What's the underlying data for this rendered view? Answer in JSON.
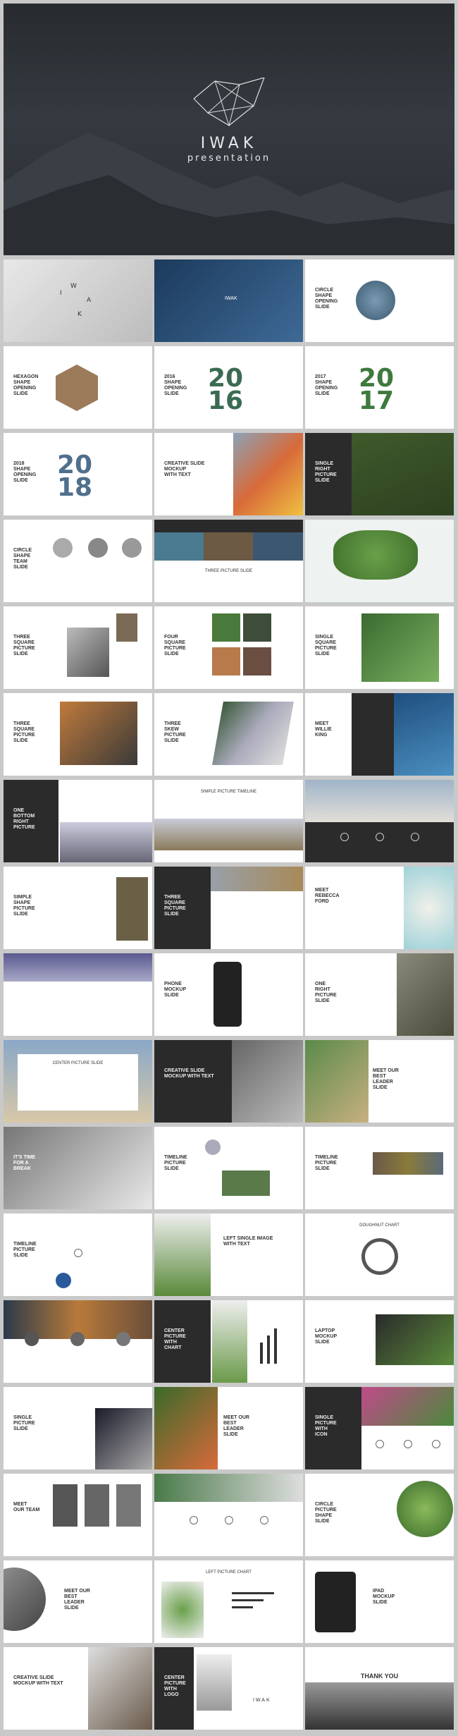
{
  "hero": {
    "title": "IWAK",
    "subtitle": "presentation"
  },
  "slides": [
    {
      "id": "s1",
      "title": ""
    },
    {
      "id": "s2",
      "title": "IWAK"
    },
    {
      "id": "s3",
      "title": "CIRCLE\nSHAPE\nOPENING\nSLIDE"
    },
    {
      "id": "s4",
      "title": "HEXAGON\nSHAPE\nOPENING\nSLIDE"
    },
    {
      "id": "s5",
      "title": "2016\nSHAPE\nOPENING\nSLIDE",
      "year": "20\n16"
    },
    {
      "id": "s6",
      "title": "2017\nSHAPE\nOPENING\nSLIDE",
      "year": "20\n17"
    },
    {
      "id": "s7",
      "title": "2018\nSHAPE\nOPENING\nSLIDE",
      "year": "20\n18"
    },
    {
      "id": "s8",
      "title": "CREATIVE SLIDE\nMOCKUP\nWITH TEXT"
    },
    {
      "id": "s9",
      "title": "SINGLE\nRIGHT\nPICTURE\nSLIDE"
    },
    {
      "id": "s10",
      "title": "CIRCLE\nSHAPE\nTEAM\nSLIDE"
    },
    {
      "id": "s11",
      "title": "THREE PICTURE SLIDE"
    },
    {
      "id": "s12",
      "title": ""
    },
    {
      "id": "s13",
      "title": "THREE\nSQUARE\nPICTURE\nSLIDE"
    },
    {
      "id": "s14",
      "title": "FOUR\nSQUARE\nPICTURE\nSLIDE"
    },
    {
      "id": "s15",
      "title": "SINGLE\nSQUARE\nPICTURE\nSLIDE"
    },
    {
      "id": "s16",
      "title": "THREE\nSQUARE\nPICTURE\nSLIDE"
    },
    {
      "id": "s17",
      "title": "THREE\nSKEW\nPICTURE\nSLIDE"
    },
    {
      "id": "s18",
      "title": "MEET\nWILLIE\nKING"
    },
    {
      "id": "s19",
      "title": "ONE\nBOTTOM\nRIGHT\nPICTURE"
    },
    {
      "id": "s20",
      "title": "SIMPLE PICTURE TIMELINE"
    },
    {
      "id": "s21",
      "title": ""
    },
    {
      "id": "s22",
      "title": "SIMPLE\nSHAPE\nPICTURE\nSLIDE"
    },
    {
      "id": "s23",
      "title": "THREE\nSQUARE\nPICTURE\nSLIDE"
    },
    {
      "id": "s24",
      "title": "MEET\nREBECCA\nFORD"
    },
    {
      "id": "s25",
      "title": ""
    },
    {
      "id": "s26",
      "title": "PHONE\nMOCKUP\nSLIDE"
    },
    {
      "id": "s27",
      "title": "ONE\nRIGHT\nPICTURE\nSLIDE"
    },
    {
      "id": "s28",
      "title": "CENTER PICTURE SLIDE"
    },
    {
      "id": "s29",
      "title": "CREATIVE SLIDE\nMOCKUP WITH TEXT"
    },
    {
      "id": "s30",
      "title": "MEET OUR\nBEST\nLEADER\nSLIDE"
    },
    {
      "id": "s31",
      "title": "IT'S TIME\nFOR A\nBREAK"
    },
    {
      "id": "s32",
      "title": "TIMELINE\nPICTURE\nSLIDE"
    },
    {
      "id": "s33",
      "title": "TIMELINE\nPICTURE\nSLIDE"
    },
    {
      "id": "s34",
      "title": "TIMELINE\nPICTURE\nSLIDE"
    },
    {
      "id": "s35",
      "title": "LEFT SINGLE IMAGE\nWITH TEXT"
    },
    {
      "id": "s36",
      "title": "DOUGHNUT CHART"
    },
    {
      "id": "s37",
      "title": ""
    },
    {
      "id": "s38",
      "title": "CENTER\nPICTURE\nWITH\nCHART"
    },
    {
      "id": "s39",
      "title": "LAPTOP\nMOCKUP\nSLIDE"
    },
    {
      "id": "s40",
      "title": "SINGLE\nPICTURE\nSLIDE"
    },
    {
      "id": "s41",
      "title": "MEET OUR\nBEST\nLEADER\nSLIDE"
    },
    {
      "id": "s42",
      "title": "SINGLE\nPICTURE\nWITH\nICON"
    },
    {
      "id": "s43",
      "title": "MEET\nOUR TEAM"
    },
    {
      "id": "s44",
      "title": ""
    },
    {
      "id": "s45",
      "title": "CIRCLE\nPICTURE\nSHAPE\nSLIDE"
    },
    {
      "id": "s46",
      "title": "MEET OUR\nBEST\nLEADER\nSLIDE"
    },
    {
      "id": "s47",
      "title": "LEFT PICTURE CHART"
    },
    {
      "id": "s48",
      "title": "IPAD\nMOCKUP\nSLIDE"
    },
    {
      "id": "s49",
      "title": "CREATIVE SLIDE\nMOCKUP WITH TEXT"
    },
    {
      "id": "s50",
      "title": "CENTER\nPICTURE\nWITH\nLOGO",
      "brand": "IWAK"
    },
    {
      "id": "s51",
      "title": "THANK YOU"
    }
  ],
  "colors": {
    "bg": "#c9c9c9",
    "dark": "#2b2b2b",
    "green": "#3b6b52"
  }
}
